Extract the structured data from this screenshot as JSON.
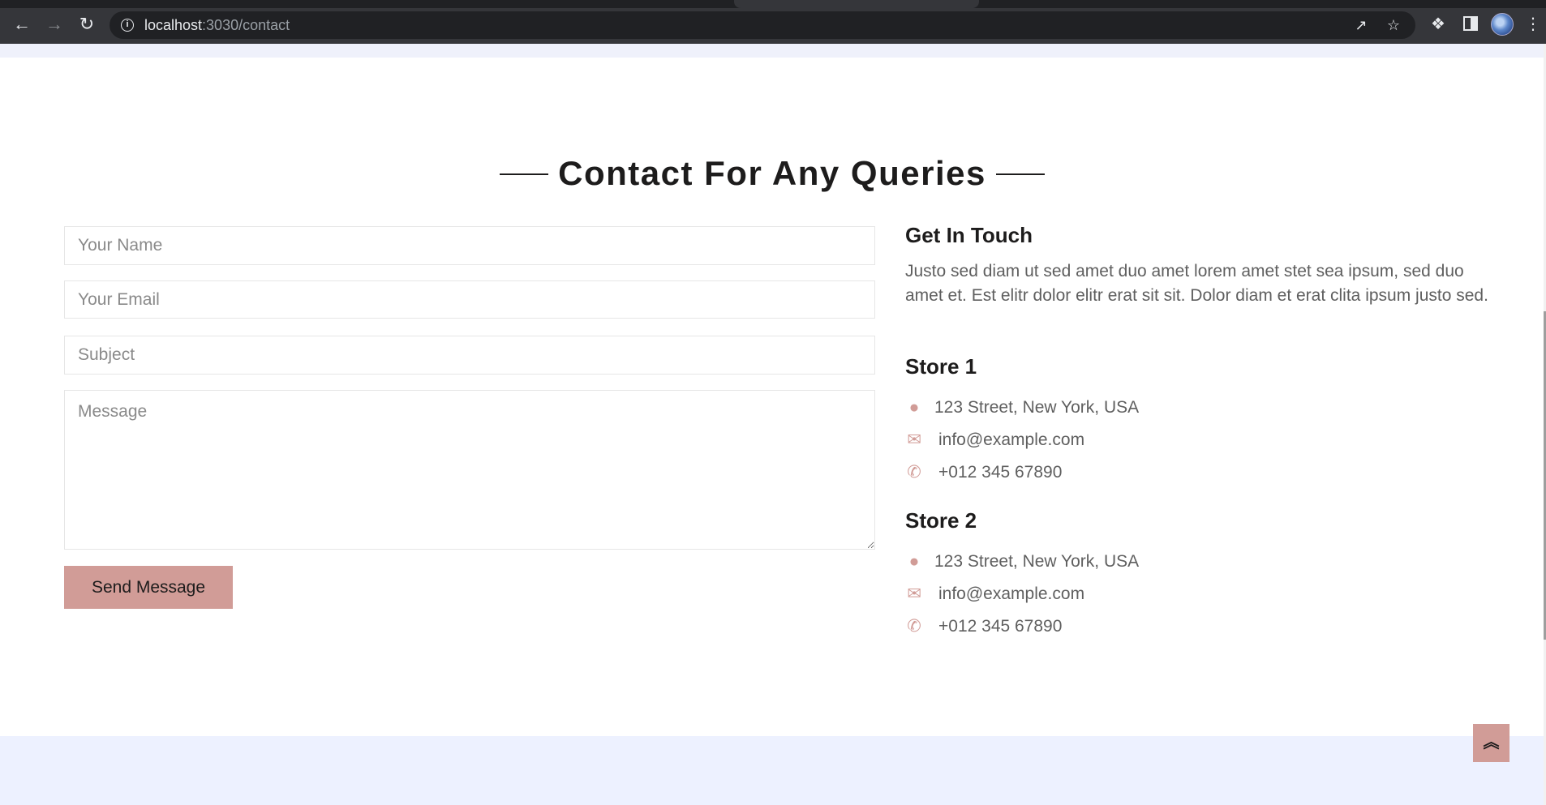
{
  "browser": {
    "url_host": "localhost",
    "url_path": ":3030/contact",
    "icons": [
      "back-arrow-icon",
      "forward-arrow-icon",
      "reload-icon",
      "info-icon",
      "share-icon",
      "star-icon",
      "puzzle-icon",
      "side-panel-icon",
      "profile-avatar",
      "more-menu-icon"
    ]
  },
  "contact": {
    "heading": "Contact For Any Queries",
    "form": {
      "name_placeholder": "Your Name",
      "email_placeholder": "Your Email",
      "subject_placeholder": "Subject",
      "message_placeholder": "Message",
      "send_label": "Send Message"
    },
    "get_in_touch": {
      "title": "Get In Touch",
      "text": "Justo sed diam ut sed amet duo amet lorem amet stet sea ipsum, sed duo amet et. Est elitr dolor elitr erat sit sit. Dolor diam et erat clita ipsum justo sed."
    },
    "stores": [
      {
        "title": "Store 1",
        "address": "123 Street, New York, USA",
        "email": "info@example.com",
        "phone": "+012 345 67890"
      },
      {
        "title": "Store 2",
        "address": "123 Street, New York, USA",
        "email": "info@example.com",
        "phone": "+012 345 67890"
      }
    ]
  },
  "colors": {
    "accent": "#d19c97",
    "heading": "#1d1c1c",
    "body_text": "#5f5f5f",
    "footer_bg": "#edf1ff"
  },
  "back_to_top": {
    "icon": "double-chevron-up-icon",
    "glyph": "︽"
  }
}
